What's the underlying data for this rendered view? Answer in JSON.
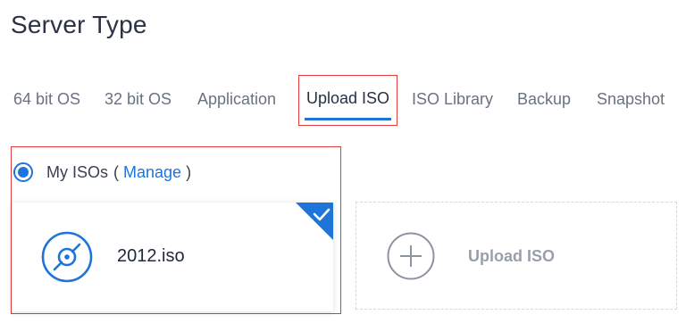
{
  "page": {
    "title": "Server Type"
  },
  "tabs": [
    {
      "label": "64 bit OS",
      "active": false
    },
    {
      "label": "32 bit OS",
      "active": false
    },
    {
      "label": "Application",
      "active": false
    },
    {
      "label": "Upload ISO",
      "active": true
    },
    {
      "label": "ISO Library",
      "active": false
    },
    {
      "label": "Backup",
      "active": false
    },
    {
      "label": "Snapshot",
      "active": false
    }
  ],
  "my_isos": {
    "label": "My ISOs",
    "open_paren": "(",
    "manage_label": "Manage",
    "close_paren": ")",
    "selected": true
  },
  "iso_card": {
    "name": "2012.iso",
    "icon": "disc-icon",
    "selected": true,
    "check_icon": "checkmark-icon"
  },
  "upload_card": {
    "label": "Upload ISO",
    "icon": "plus-circle-icon"
  },
  "colors": {
    "accent": "#1e74d9",
    "highlight_border": "#e23b3b",
    "muted_text": "#9aa0aa"
  }
}
